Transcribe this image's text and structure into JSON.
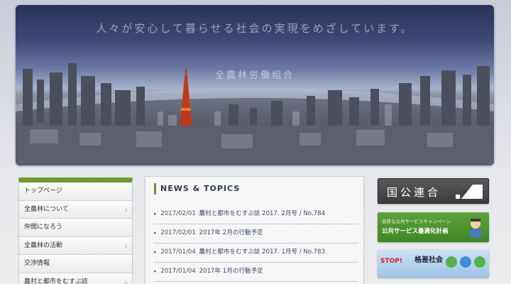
{
  "hero": {
    "tagline": "人々が安心して暮らせる社会の実現をめざしています。",
    "organization": "全農林労働組合"
  },
  "nav": {
    "items": [
      {
        "label": "トップページ",
        "has_arrow": false
      },
      {
        "label": "全農林について",
        "has_arrow": true
      },
      {
        "label": "仲間になろう",
        "has_arrow": false
      },
      {
        "label": "全農林の活動",
        "has_arrow": true
      },
      {
        "label": "交渉情報",
        "has_arrow": false
      },
      {
        "label": "農村と都市をむすぶ誌",
        "has_arrow": true
      }
    ],
    "arrow": "›"
  },
  "news": {
    "heading": "NEWS & TOPICS",
    "bullet": "▸",
    "items": [
      {
        "date": "2017/02/01",
        "title": "農村と都市をむすぶ誌 2017. 2月号 / No.784"
      },
      {
        "date": "2017/02/01",
        "title": "2017年 2月の行動予定"
      },
      {
        "date": "2017/01/04",
        "title": "農村と都市をむすぶ誌 2017. 1月号 / No.783"
      },
      {
        "date": "2017/01/04",
        "title": "2017年 1月の行動予定"
      }
    ]
  },
  "banners": {
    "kokko": {
      "label": "国公連合"
    },
    "public_service": {
      "caption": "良質な公共サービスキャンペーン",
      "title": "公共サービス最適化計画"
    },
    "stop": {
      "stop_label": "STOP!",
      "title": "格差社会"
    }
  },
  "colors": {
    "accent_green": "#6c9a2c",
    "news_heading": "#2f3a57",
    "link_text": "#3b4a6b"
  }
}
